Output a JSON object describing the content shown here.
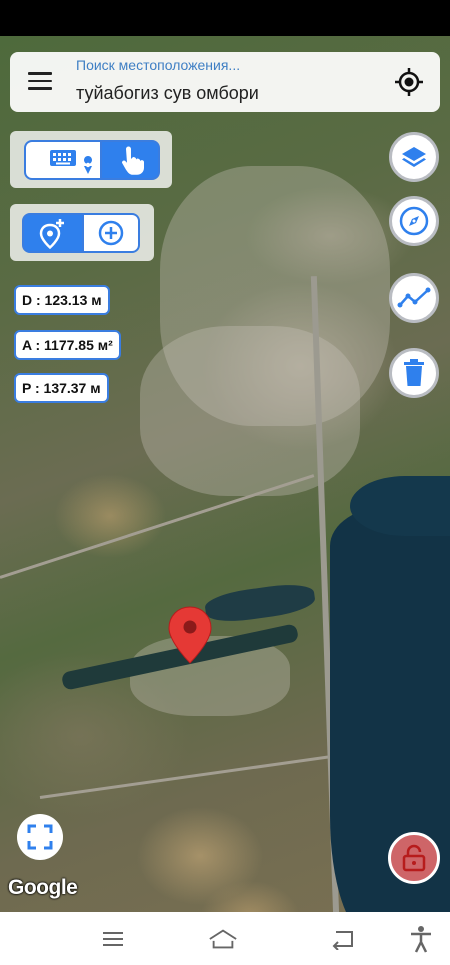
{
  "search": {
    "placeholder": "Поиск местоположения...",
    "query": "туйабогиз сув омбори"
  },
  "measurements": {
    "distance": "D : 123.13 м",
    "area": "A : 1177.85 м²",
    "perimeter": "P : 137.37 м"
  },
  "map": {
    "attribution": "Google"
  },
  "icons": {
    "menu": "menu-icon",
    "locate": "crosshair-icon",
    "keyboard": "keyboard-icon",
    "touch": "hand-pointer-icon",
    "add_pin": "add-location-icon",
    "add": "plus-circle-icon",
    "layers": "layers-icon",
    "compass": "compass-icon",
    "path": "polyline-icon",
    "delete": "trash-icon",
    "lock": "lock-icon",
    "fullscreen": "fullscreen-icon",
    "marker": "map-pin-icon"
  },
  "colors": {
    "accent": "#2f80ed",
    "pin": "#e53935",
    "lock": "#f06e6e"
  }
}
